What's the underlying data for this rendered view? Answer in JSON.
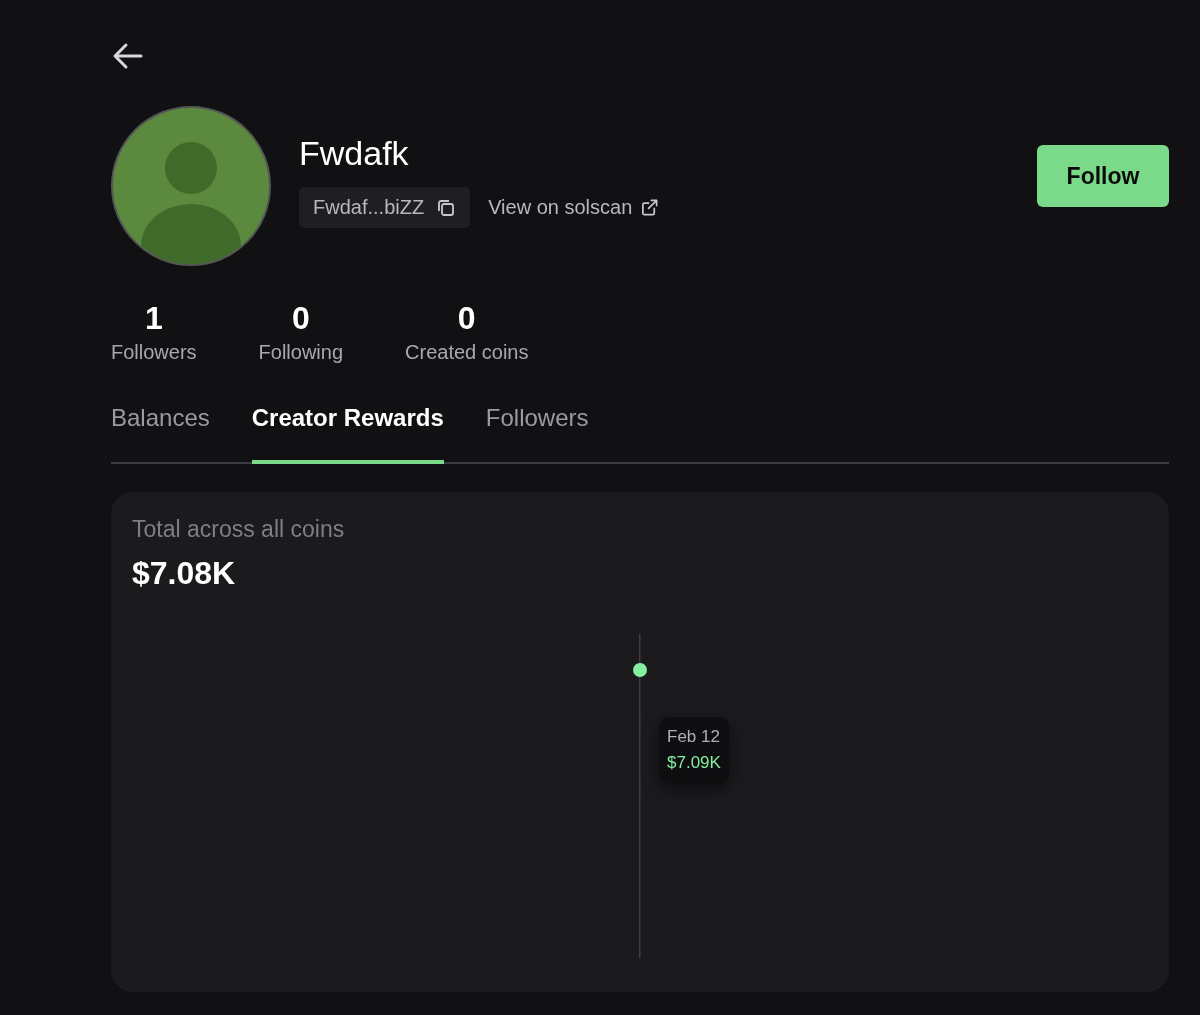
{
  "profile": {
    "name": "Fwdafk",
    "address": "Fwdaf...biZZ",
    "solscan_link": "View on solscan",
    "follow_button": "Follow"
  },
  "stats": [
    {
      "value": "1",
      "label": "Followers"
    },
    {
      "value": "0",
      "label": "Following"
    },
    {
      "value": "0",
      "label": "Created coins"
    }
  ],
  "tabs": [
    {
      "label": "Balances",
      "selected": false
    },
    {
      "label": "Creator Rewards",
      "selected": true
    },
    {
      "label": "Followers",
      "selected": false
    }
  ],
  "rewards": {
    "title": "Total across all coins",
    "total": "$7.08K",
    "tooltip": {
      "date": "Feb 12",
      "value": "$7.09K"
    }
  }
}
